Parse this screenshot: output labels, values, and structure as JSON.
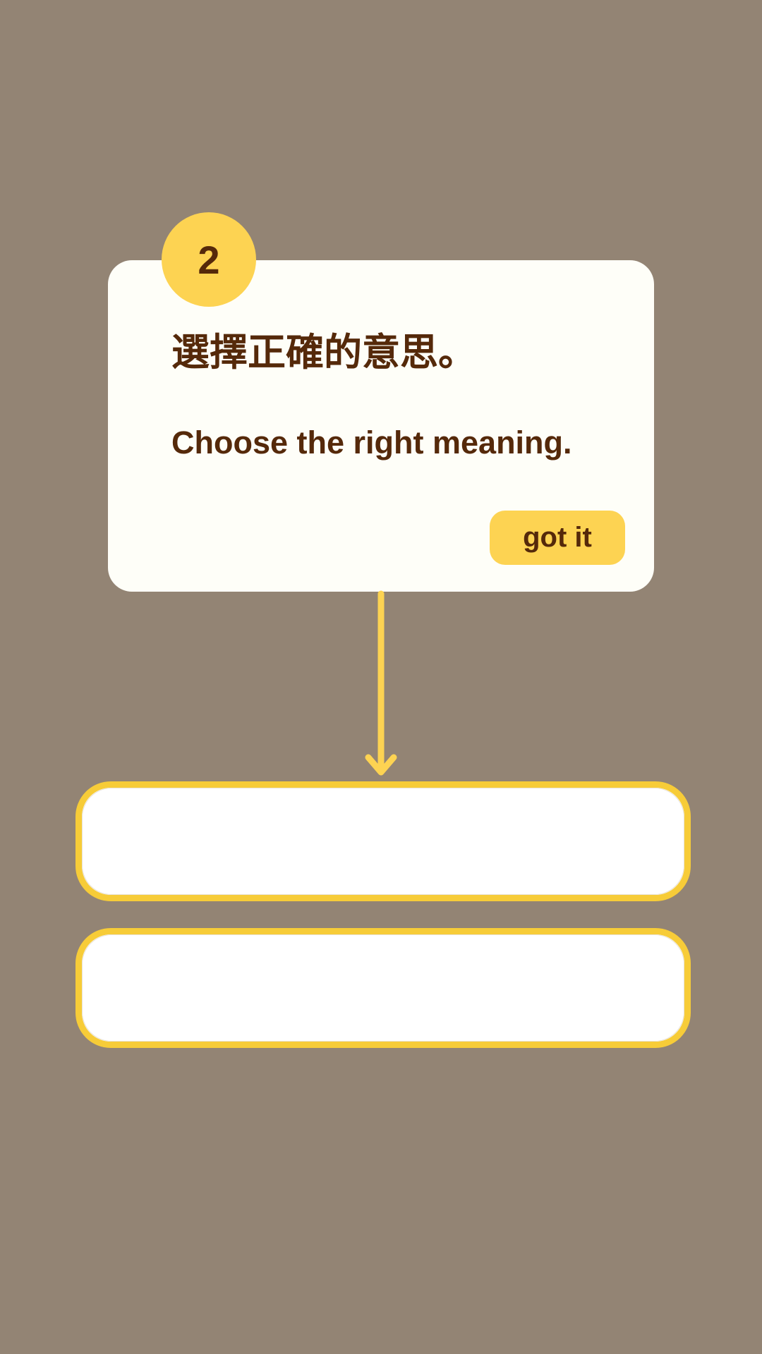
{
  "tip": {
    "step_number": "2",
    "title": "選擇正確的意思。",
    "subtitle": "Choose the right meaning.",
    "dismiss_label": "got it"
  },
  "answer_options": [
    "",
    ""
  ],
  "colors": {
    "overlay_background": "#938474",
    "card_background": "#FEFEF8",
    "accent_yellow": "#FDD352",
    "option_border": "#F7CC38",
    "text_brown": "#55290A"
  },
  "icons": {
    "pointer": "arrow-down-icon"
  }
}
